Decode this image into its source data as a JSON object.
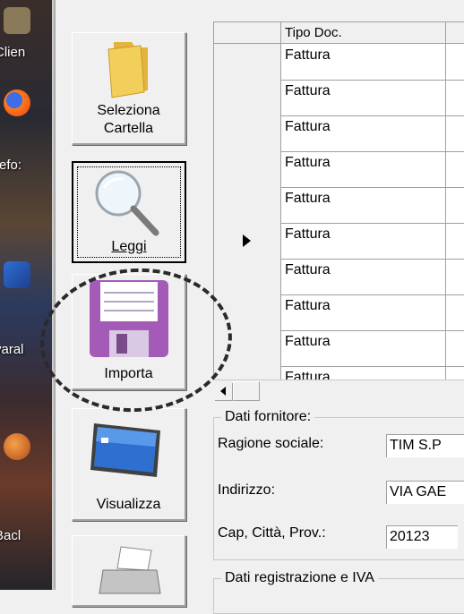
{
  "desktop": {
    "items": [
      {
        "label": "Clien"
      },
      {
        "label": "refo:"
      },
      {
        "label": "varal"
      },
      {
        "label": "Bacl"
      }
    ]
  },
  "toolbar": {
    "buttons": [
      {
        "label_line1": "Seleziona",
        "label_line2": "Cartella",
        "icon": "folder-icon"
      },
      {
        "label_line1": "Leggi",
        "icon": "magnifier-icon"
      },
      {
        "label_line1": "Importa",
        "icon": "floppy-disk-icon"
      },
      {
        "label_line1": "Visualizza",
        "icon": "monitor-icon"
      },
      {
        "icon": "printer-icon"
      }
    ]
  },
  "grid": {
    "column_header": "Tipo Doc.",
    "rows": [
      "Fattura",
      "Fattura",
      "Fattura",
      "Fattura",
      "Fattura",
      "Fattura",
      "Fattura",
      "Fattura",
      "Fattura",
      "Fattura"
    ],
    "selected_row_index": 5
  },
  "supplier": {
    "legend": "Dati fornitore:",
    "ragione_label": "Ragione sociale:",
    "ragione_value": "TIM  S.P",
    "indirizzo_label": "Indirizzo:",
    "indirizzo_value": "VIA GAE",
    "cap_label": "Cap, Città, Prov.:",
    "cap_value": "20123"
  },
  "registration": {
    "legend": "Dati registrazione e IVA"
  },
  "colors": {
    "window_bg": "#f0f0f0",
    "folder_yellow": "#f2cf5b",
    "floppy_purple": "#a45bb8",
    "monitor_blue": "#2e6fd0"
  }
}
